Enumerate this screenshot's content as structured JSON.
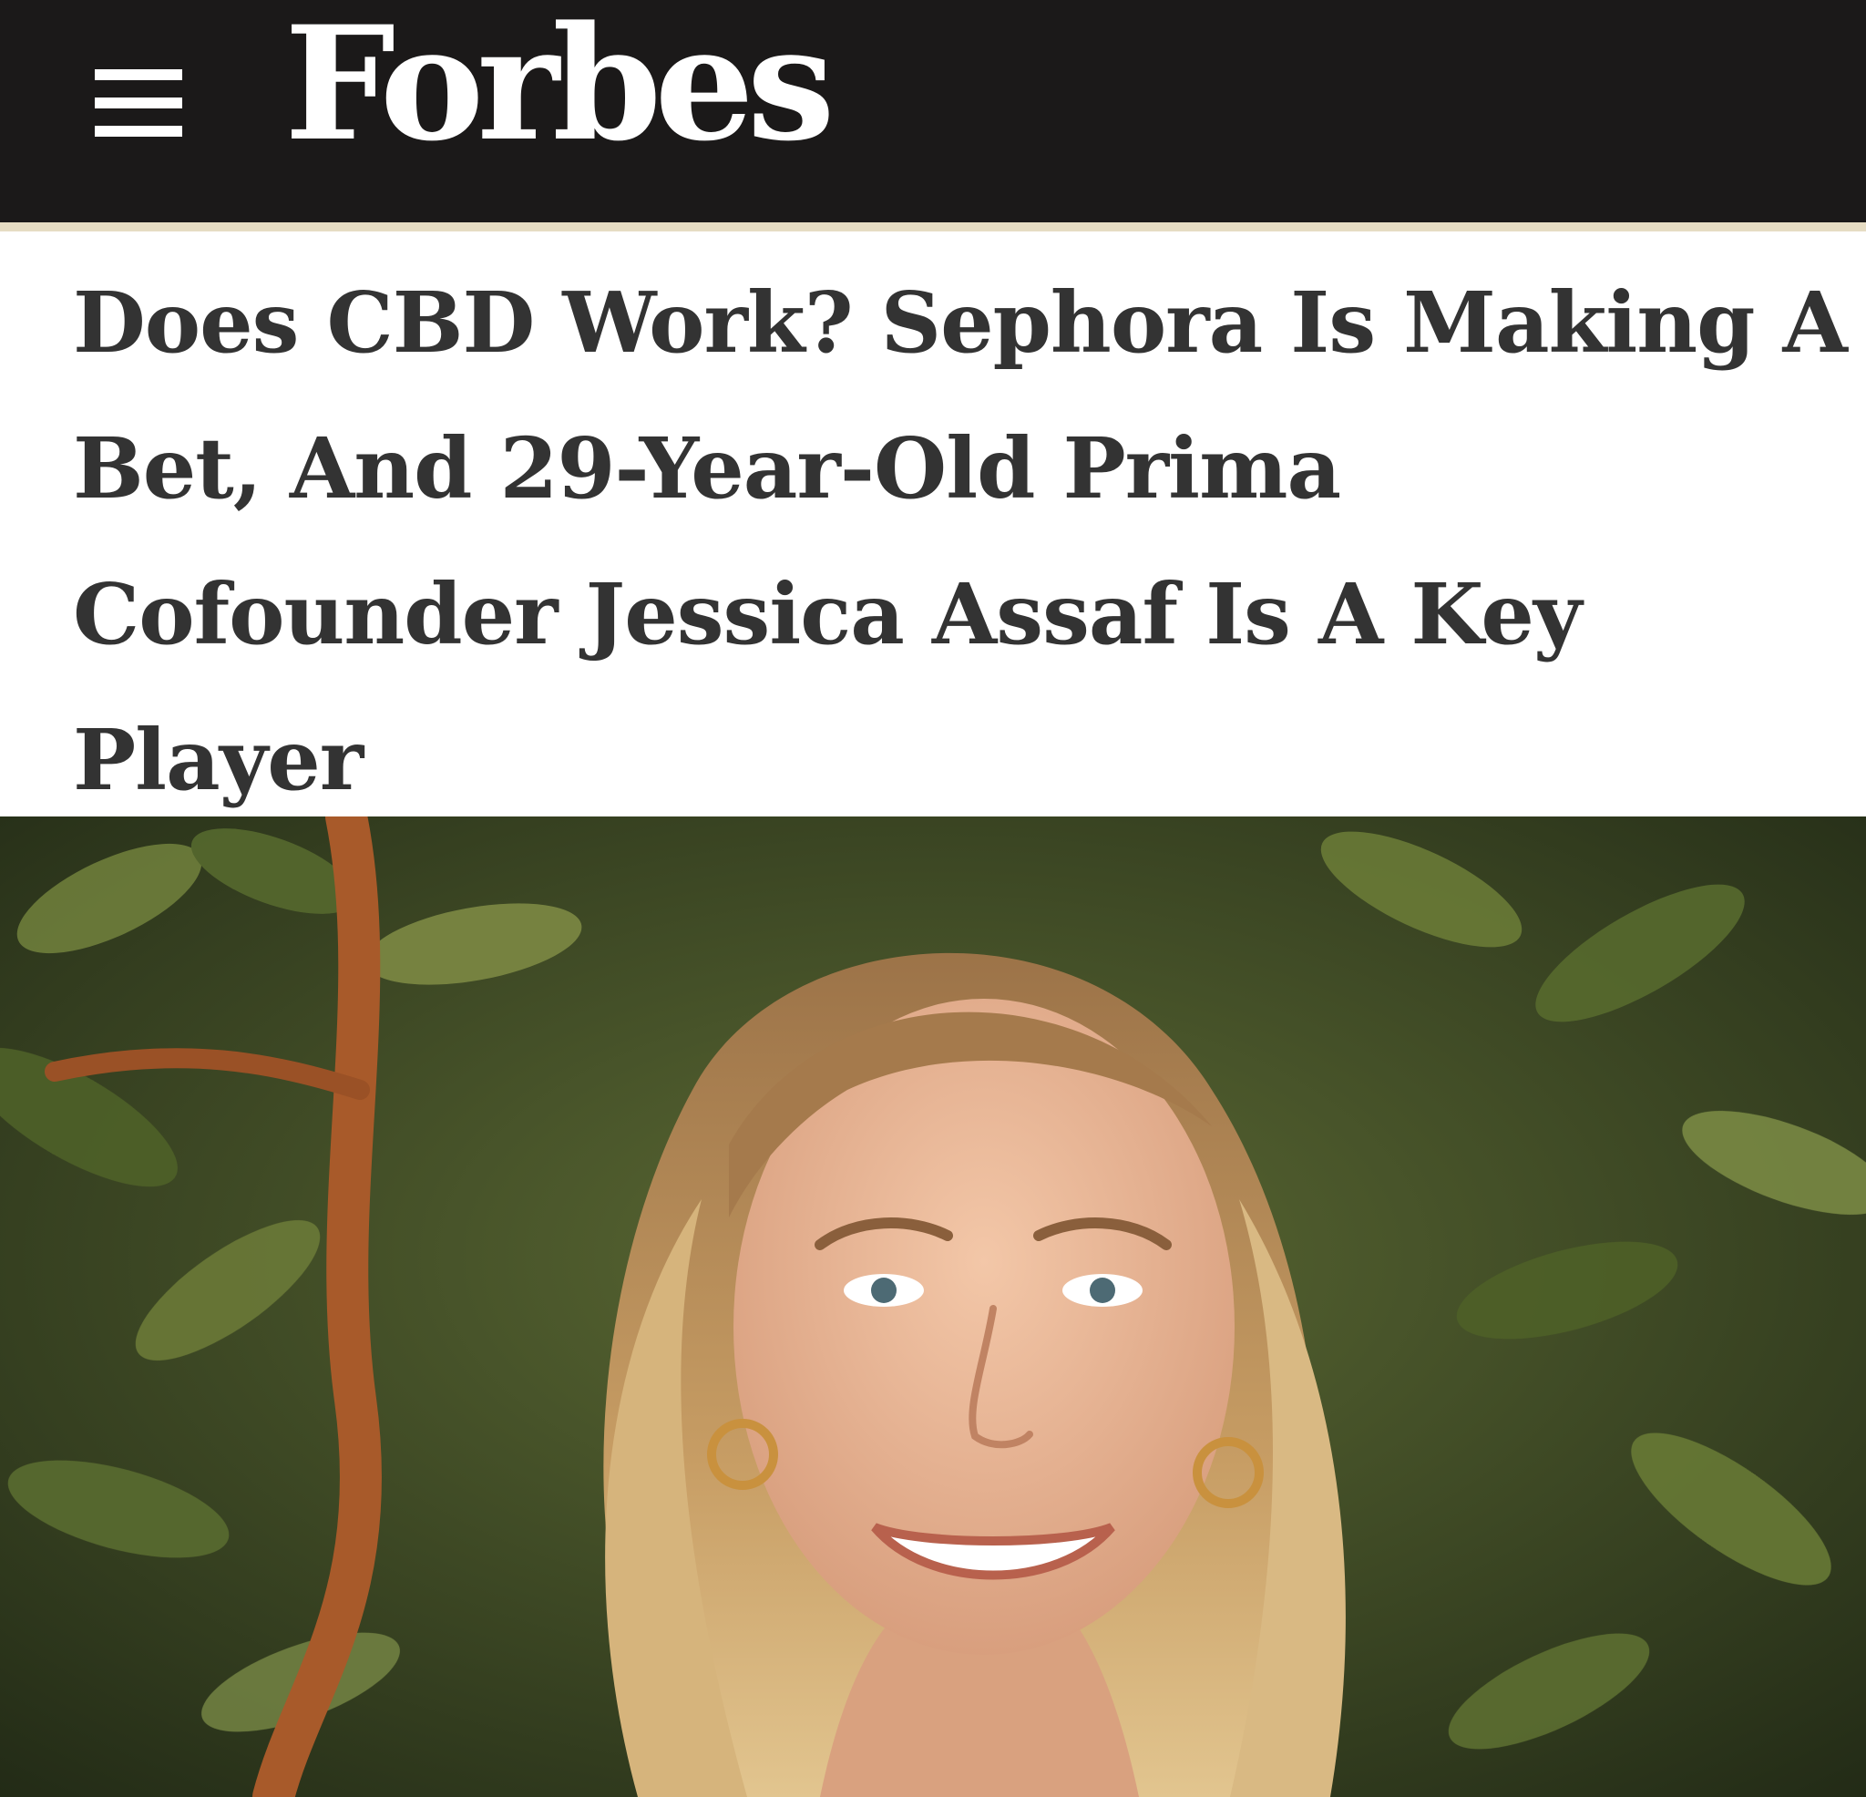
{
  "header": {
    "logo_text": "Forbes",
    "menu_icon": "hamburger-menu-icon",
    "background_color": "#1b1919",
    "accent_rule_color": "#e6dcc3"
  },
  "article": {
    "headline": "Does CBD Work? Sephora Is Making A Bet, And 29-Year-Old Prima Cofounder Jessica Assaf Is A Key Player",
    "headline_color": "#333333"
  },
  "hero_image": {
    "subject": "portrait-photo"
  }
}
